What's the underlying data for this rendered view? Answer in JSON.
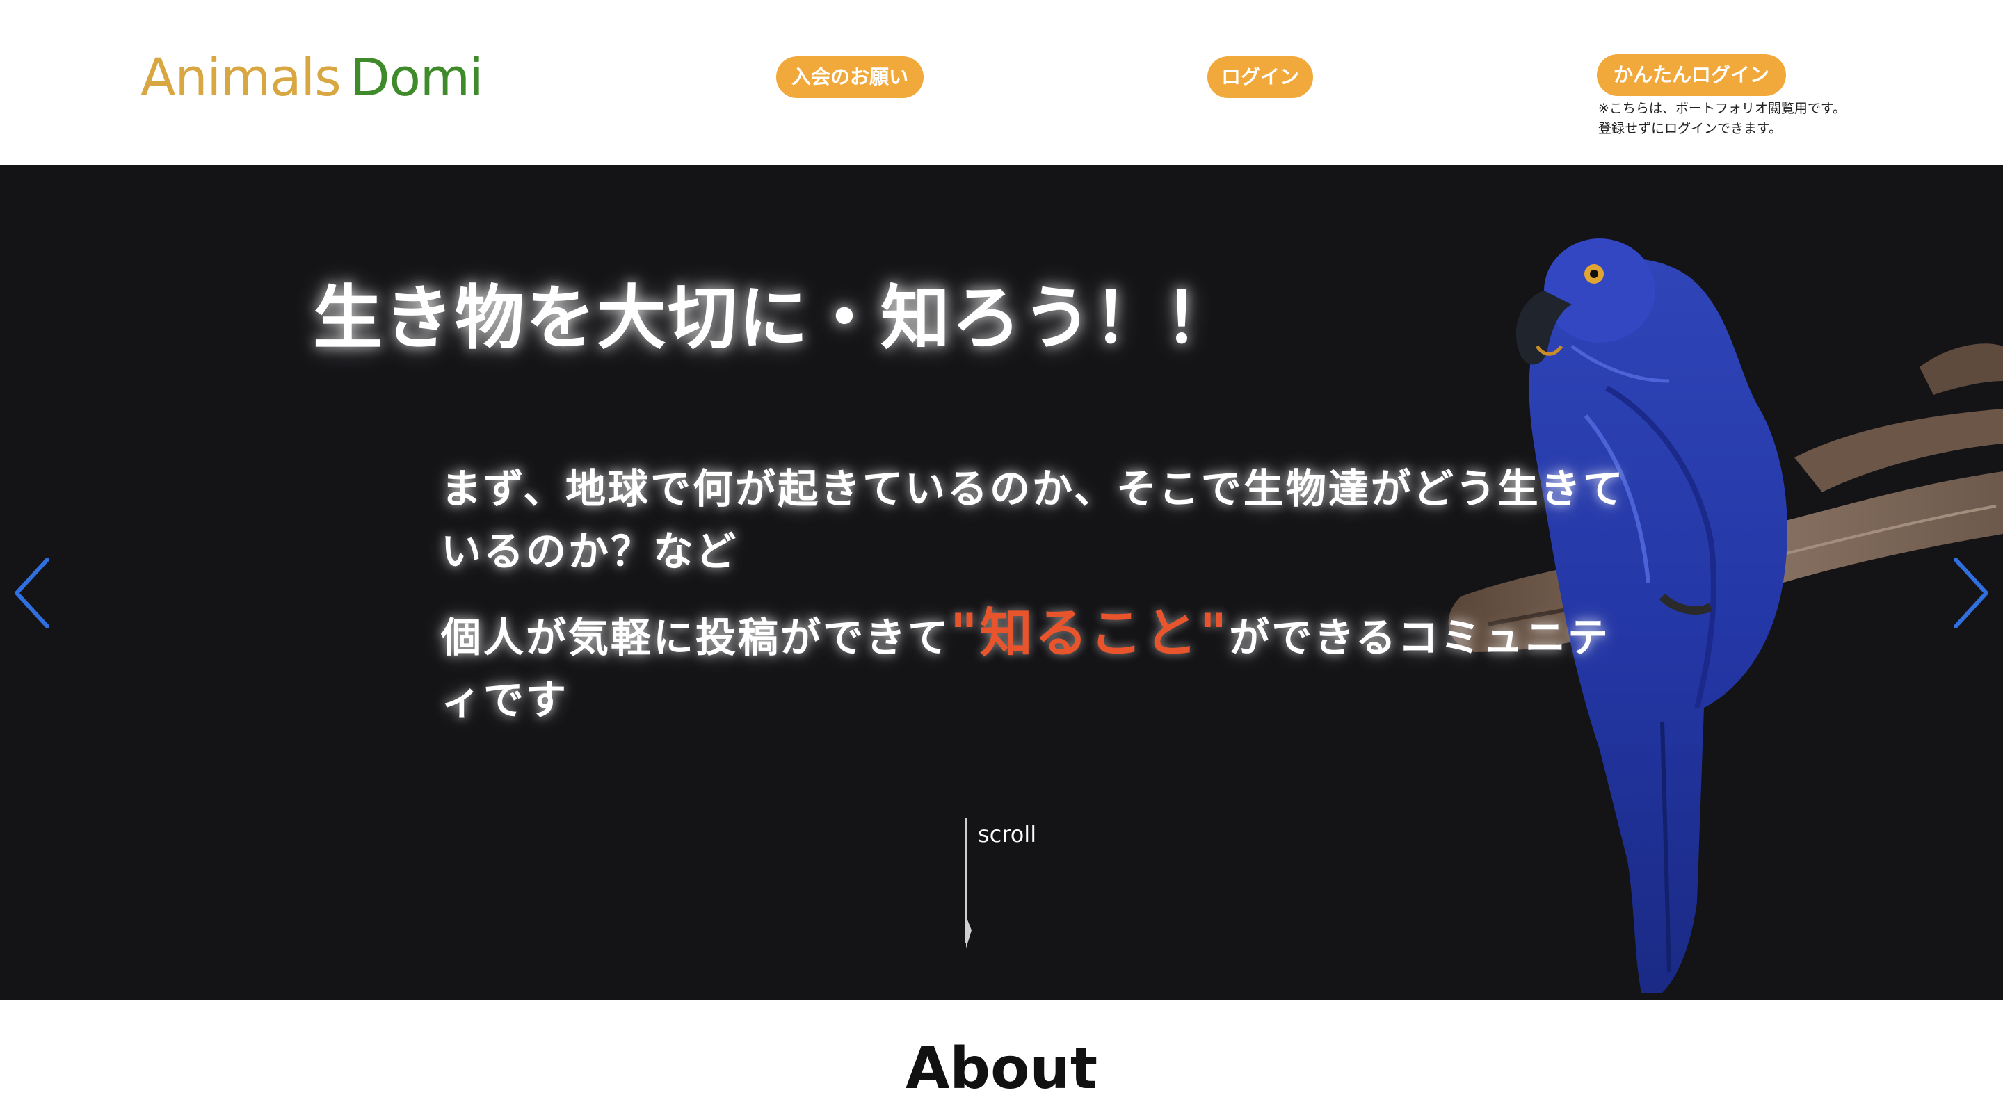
{
  "header": {
    "logo_word1": "Animals",
    "logo_word2": "Domi",
    "join_label": "入会のお願い",
    "login_label": "ログイン",
    "easy_login_label": "かんたんログイン",
    "easy_login_note_line1": "※こちらは、ポートフォリオ閲覧用です。",
    "easy_login_note_line2": "登録せずにログインできます。"
  },
  "hero": {
    "title": "生き物を大切に・知ろう！！",
    "desc_line1": "まず、地球で何が起きているのか、そこで生物達がどう生きているのか？など",
    "desc_line2_before": "個人が気軽に投稿ができて",
    "desc_line2_highlight": "\"知ること\"",
    "desc_line2_after": "ができるコミュニティです",
    "scroll_label": "scroll"
  },
  "about": {
    "title": "About"
  },
  "colors": {
    "logo_word1": "#d9a741",
    "logo_word2": "#3f8a2a",
    "button": "#f2a93b",
    "hero_bg": "#141316",
    "highlight": "#e8542b",
    "arrow": "#2f6fe0"
  },
  "icons": {
    "prev": "chevron-left-icon",
    "next": "chevron-right-icon"
  }
}
